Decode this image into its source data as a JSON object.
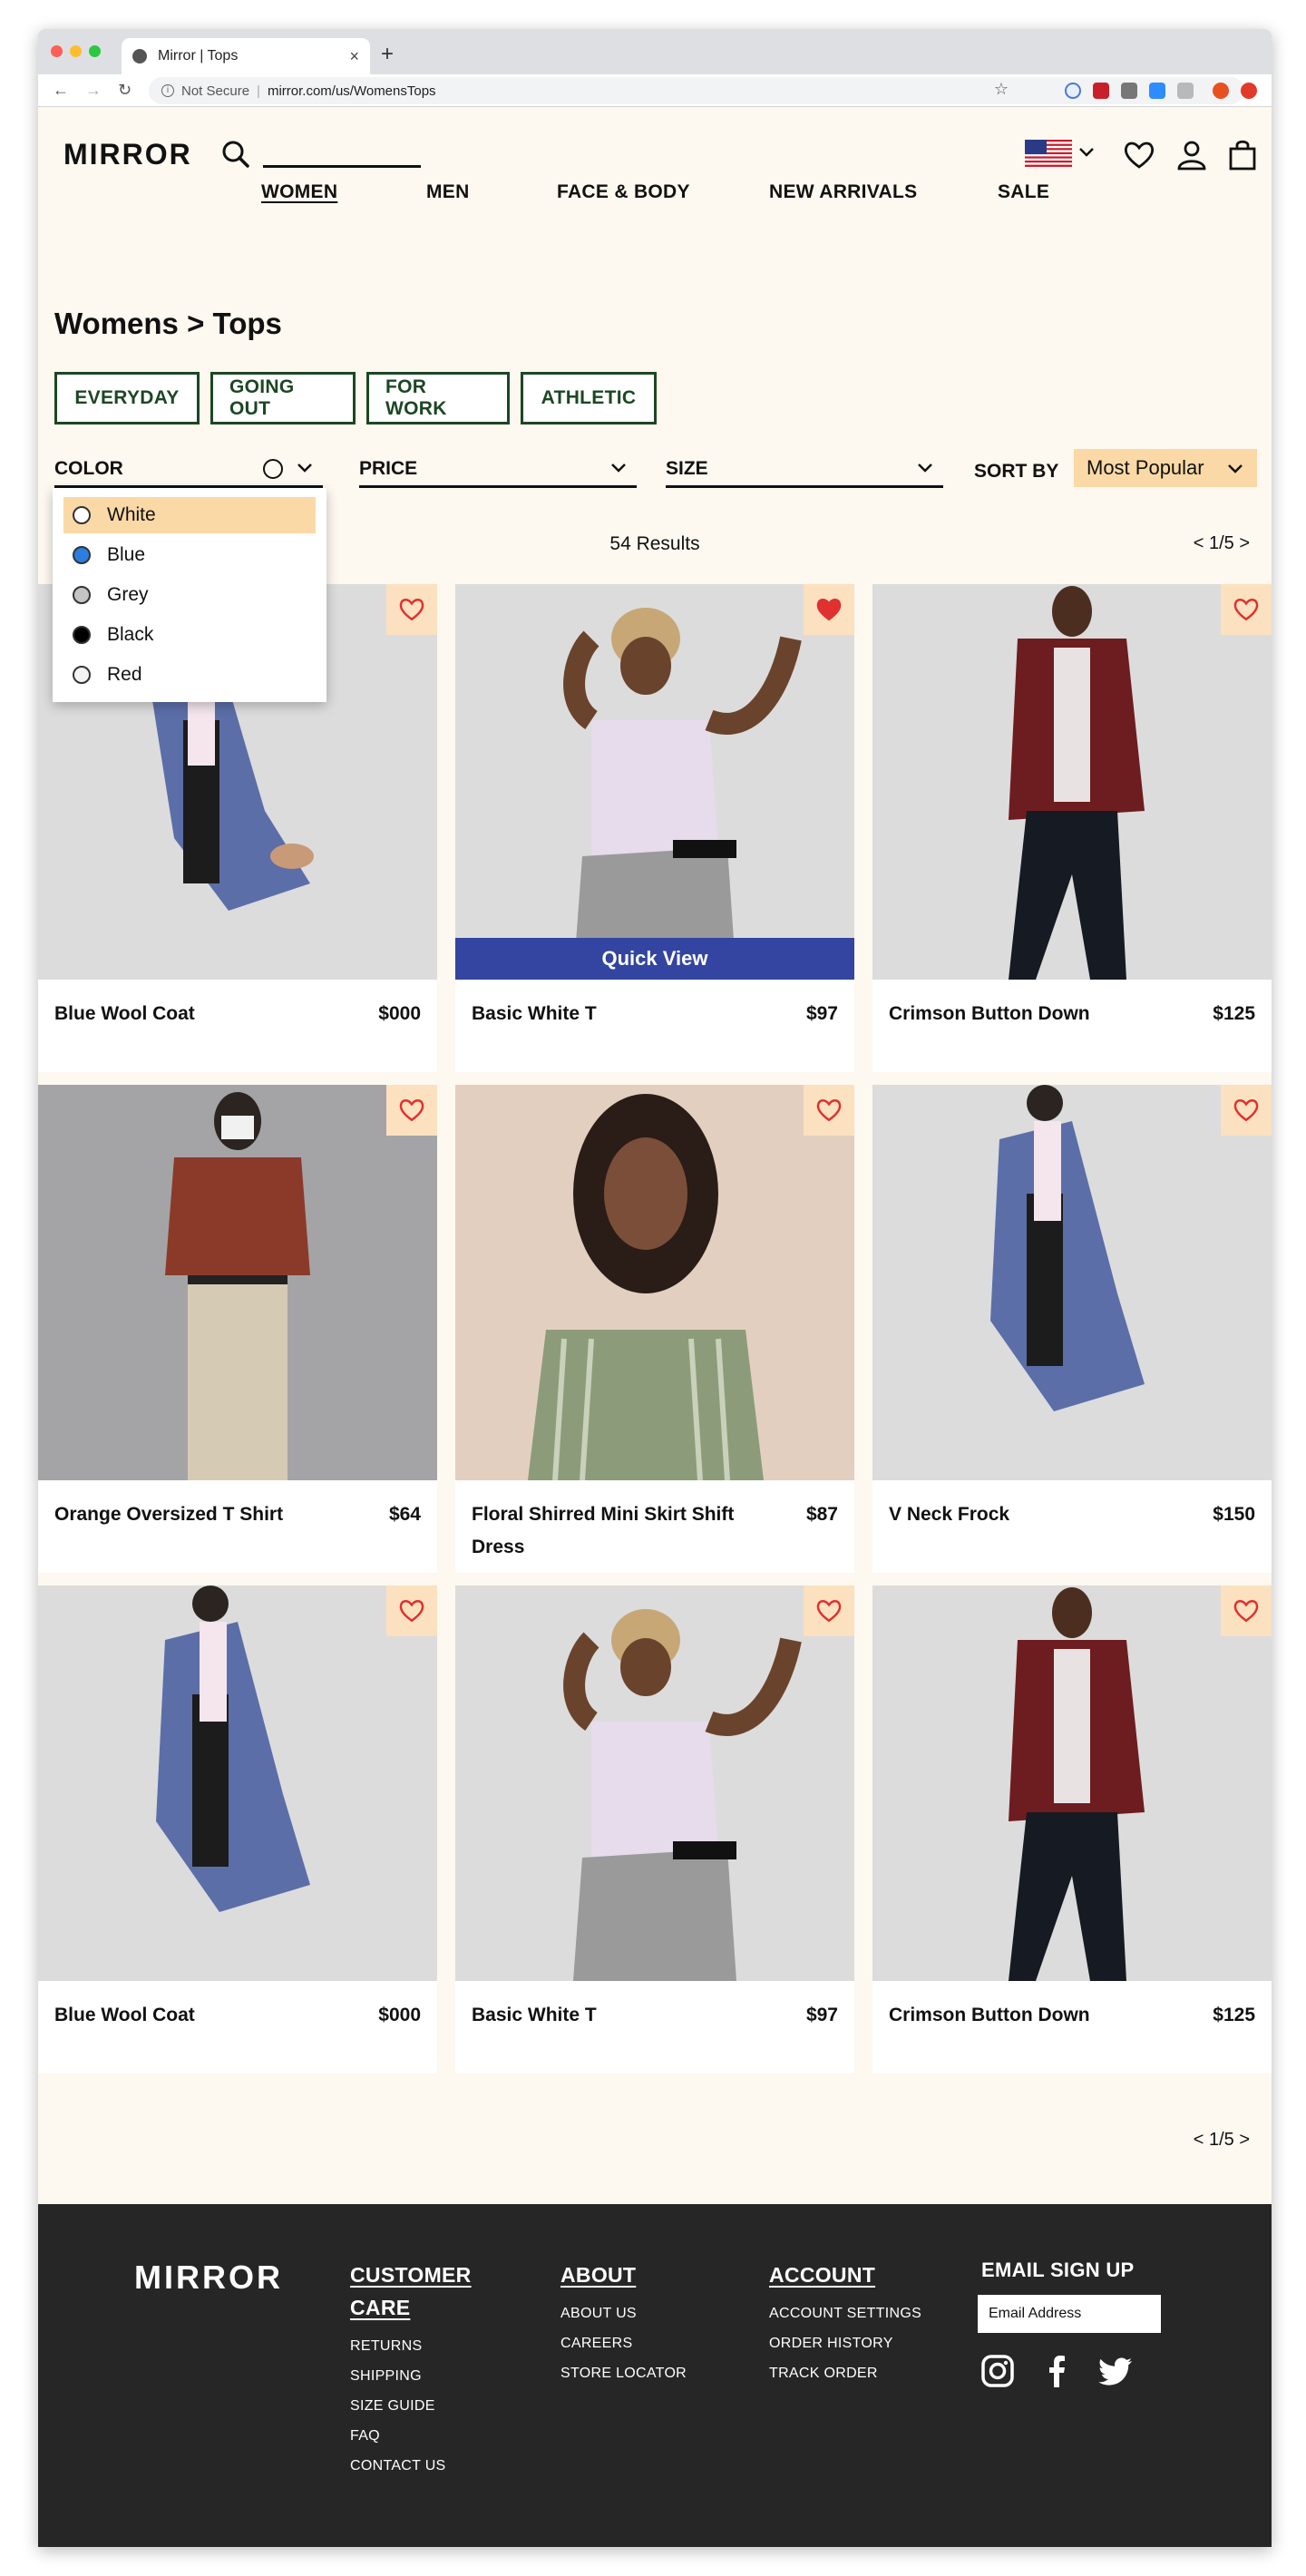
{
  "browser": {
    "tab_title": "Mirror | Tops",
    "tab_close": "×",
    "new_tab": "+",
    "not_secure": "Not Secure",
    "separator": "|",
    "url": "mirror.com/us/WomensTops",
    "nav_back": "←",
    "nav_forward": "→",
    "nav_reload": "↻",
    "info": "i",
    "star": "☆"
  },
  "header": {
    "logo": "MIRROR",
    "flag_chevron": "⌄"
  },
  "nav": [
    "WOMEN",
    "MEN",
    "FACE & BODY",
    "NEW ARRIVALS",
    "SALE"
  ],
  "breadcrumb": "Womens > Tops",
  "chips": [
    "EVERYDAY",
    "GOING OUT",
    "FOR WORK",
    "ATHLETIC"
  ],
  "filters": {
    "color": "COLOR",
    "price": "PRICE",
    "size": "SIZE",
    "sort_label": "SORT BY",
    "sort_value": "Most Popular"
  },
  "color_options": [
    {
      "label": "White",
      "color": "#ffffff",
      "selected": true
    },
    {
      "label": "Blue",
      "color": "#2b7de0",
      "selected": false
    },
    {
      "label": "Grey",
      "color": "#c4c4c4",
      "selected": false
    },
    {
      "label": "Black",
      "color": "#000000",
      "selected": false
    },
    {
      "label": "Red",
      "color": "#f4f4f4",
      "selected": false
    }
  ],
  "results": "54 Results",
  "pagination": "< 1/5 >",
  "products": [
    {
      "name": "Blue Wool Coat",
      "price": "$000",
      "favorited": false
    },
    {
      "name": "Basic White T",
      "price": "$97",
      "favorited": true,
      "quick_view": "Quick View"
    },
    {
      "name": "Crimson Button Down",
      "price": "$125",
      "favorited": false
    },
    {
      "name": "Orange Oversized T Shirt",
      "price": "$64",
      "favorited": false
    },
    {
      "name": "Floral Shirred Mini Skirt Shift Dress",
      "price": "$87",
      "favorited": false
    },
    {
      "name": "V Neck Frock",
      "price": "$150",
      "favorited": false
    },
    {
      "name": "Blue Wool Coat",
      "price": "$000",
      "favorited": false
    },
    {
      "name": "Basic White T",
      "price": "$97",
      "favorited": false
    },
    {
      "name": "Crimson Button Down",
      "price": "$125",
      "favorited": false
    }
  ],
  "footer": {
    "logo": "MIRROR",
    "customer_care": {
      "title_1": "CUSTOMER",
      "title_2": "CARE",
      "links": [
        "RETURNS",
        "SHIPPING",
        "SIZE GUIDE",
        "FAQ",
        "CONTACT US"
      ]
    },
    "about": {
      "title": "ABOUT",
      "links": [
        "ABOUT US",
        "CAREERS",
        "STORE LOCATOR"
      ]
    },
    "account": {
      "title": "ACCOUNT",
      "links": [
        "ACCOUNT SETTINGS",
        "ORDER HISTORY",
        "TRACK ORDER"
      ]
    },
    "email_title": "EMAIL SIGN UP",
    "email_placeholder": "Email Address"
  },
  "colors": {
    "accent_green": "#1c4724",
    "sort_bg": "#fbd9a6",
    "quick_view_bg": "#3345a1",
    "heart_red": "#e0302f",
    "footer_bg": "#262626",
    "page_bg": "#fdf8f0"
  }
}
